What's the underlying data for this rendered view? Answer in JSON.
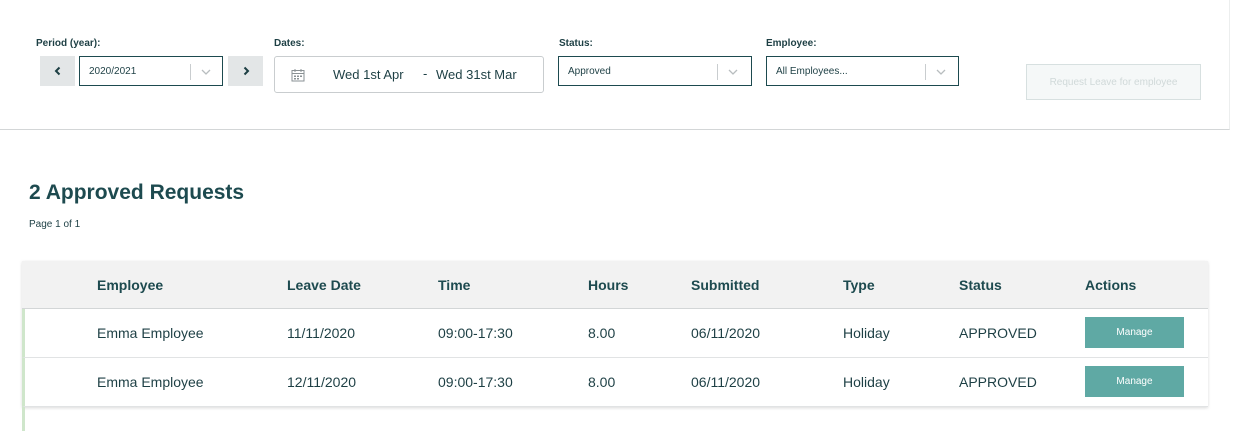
{
  "filters": {
    "period_label": "Period (year):",
    "period_value": "2020/2021",
    "dates_label": "Dates:",
    "date_from": "Wed 1st Apr",
    "date_separator": "-",
    "date_to": "Wed 31st Mar",
    "status_label": "Status:",
    "status_value": "Approved",
    "employee_label": "Employee:",
    "employee_value": "All Employees..."
  },
  "request_button_label": "Request Leave for employee",
  "heading": "2 Approved Requests",
  "page_info": "Page 1 of 1",
  "table": {
    "headers": [
      "Employee",
      "Leave Date",
      "Time",
      "Hours",
      "Submitted",
      "Type",
      "Status",
      "Actions"
    ],
    "rows": [
      {
        "employee": "Emma Employee",
        "leave_date": "11/11/2020",
        "time": "09:00-17:30",
        "hours": "8.00",
        "submitted": "06/11/2020",
        "type": "Holiday",
        "status": "APPROVED",
        "action": "Manage"
      },
      {
        "employee": "Emma Employee",
        "leave_date": "12/11/2020",
        "time": "09:00-17:30",
        "hours": "8.00",
        "submitted": "06/11/2020",
        "type": "Holiday",
        "status": "APPROVED",
        "action": "Manage"
      }
    ]
  },
  "colors": {
    "primary_text": "#1d4a4f",
    "button_teal": "#5fa9a4",
    "row_accent": "#cfe6cb"
  }
}
